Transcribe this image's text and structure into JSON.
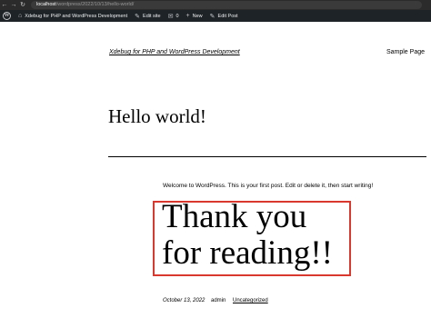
{
  "browser": {
    "url_host": "localhost",
    "url_path": "/wordpress/2022/10/13/hello-world/"
  },
  "admin_bar": {
    "site_name": "Xdebug for PHP and WordPress Development",
    "edit_site": "Edit site",
    "comments_count": "0",
    "new_label": "New",
    "edit_post": "Edit Post"
  },
  "site": {
    "title": "Xdebug for PHP and WordPress Development",
    "nav_item": "Sample Page"
  },
  "post": {
    "title": "Hello world!",
    "welcome_text": "Welcome to WordPress. This is your first post. Edit or delete it, then start writing!",
    "highlight_text": "Thank you for reading!!",
    "date": "October 13, 2022",
    "author": "admin",
    "category": "Uncategorized"
  },
  "colors": {
    "admin_bar_bg": "#1d2327",
    "browser_bar_bg": "#2b2b2b",
    "callout_border": "#d9382f"
  }
}
